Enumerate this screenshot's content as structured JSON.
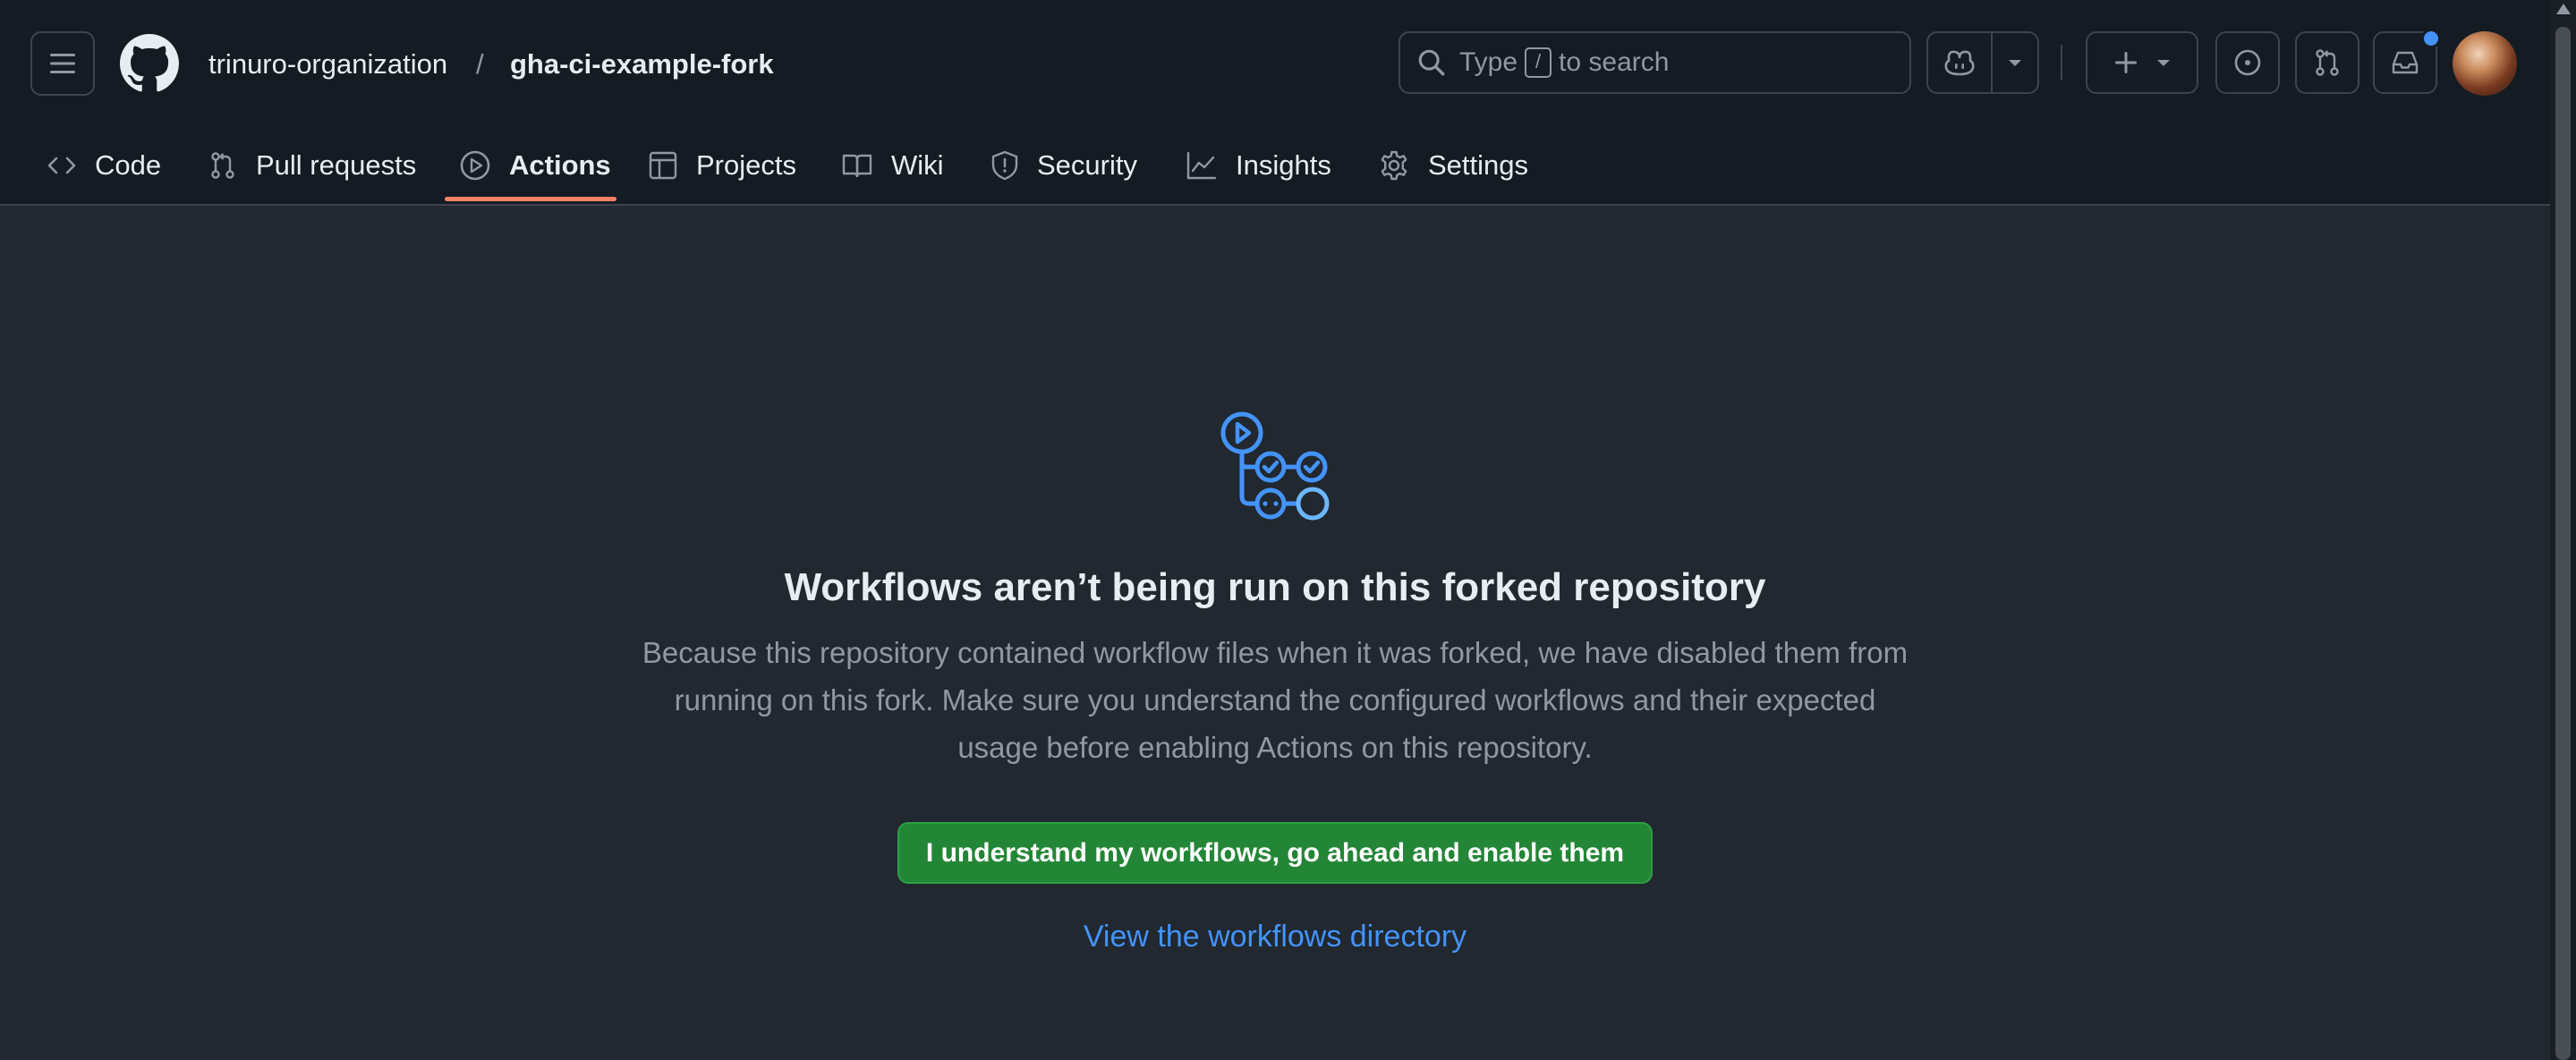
{
  "header": {
    "owner": "trinuro-organization",
    "separator": "/",
    "repo": "gha-ci-example-fork",
    "search": {
      "prefix": "Type",
      "key": "/",
      "suffix": "to search"
    },
    "icons": [
      "hamburger-menu-icon",
      "github-logo-icon",
      "search-icon",
      "copilot-icon",
      "chevron-down-icon",
      "plus-icon",
      "issues-icon",
      "pull-request-icon",
      "inbox-icon"
    ],
    "notification_dot_color": "#4493f8"
  },
  "tabs": [
    {
      "label": "Code",
      "icon": "code-icon"
    },
    {
      "label": "Pull requests",
      "icon": "pull-request-icon"
    },
    {
      "label": "Actions",
      "icon": "play-icon",
      "active": true
    },
    {
      "label": "Projects",
      "icon": "table-icon"
    },
    {
      "label": "Wiki",
      "icon": "book-icon"
    },
    {
      "label": "Security",
      "icon": "shield-icon"
    },
    {
      "label": "Insights",
      "icon": "graph-icon"
    },
    {
      "label": "Settings",
      "icon": "gear-icon"
    }
  ],
  "main": {
    "icon": "workflow-icon",
    "title": "Workflows aren’t being run on this forked repository",
    "description_lines": [
      "Because this repository contained workflow files when it was forked, we have disabled them from",
      "running on this fork. Make sure you understand the configured workflows and their expected",
      "usage before enabling Actions on this repository."
    ],
    "enable_button": "I understand my workflows, go ahead and enable them",
    "view_link": "View the workflows directory"
  },
  "colors": {
    "page_bg": "#212830",
    "header_bg": "#151b23",
    "accent_underline": "#f78166",
    "primary_button": "#238636",
    "link": "#4493f8",
    "icon_blue": "#4493f8"
  }
}
